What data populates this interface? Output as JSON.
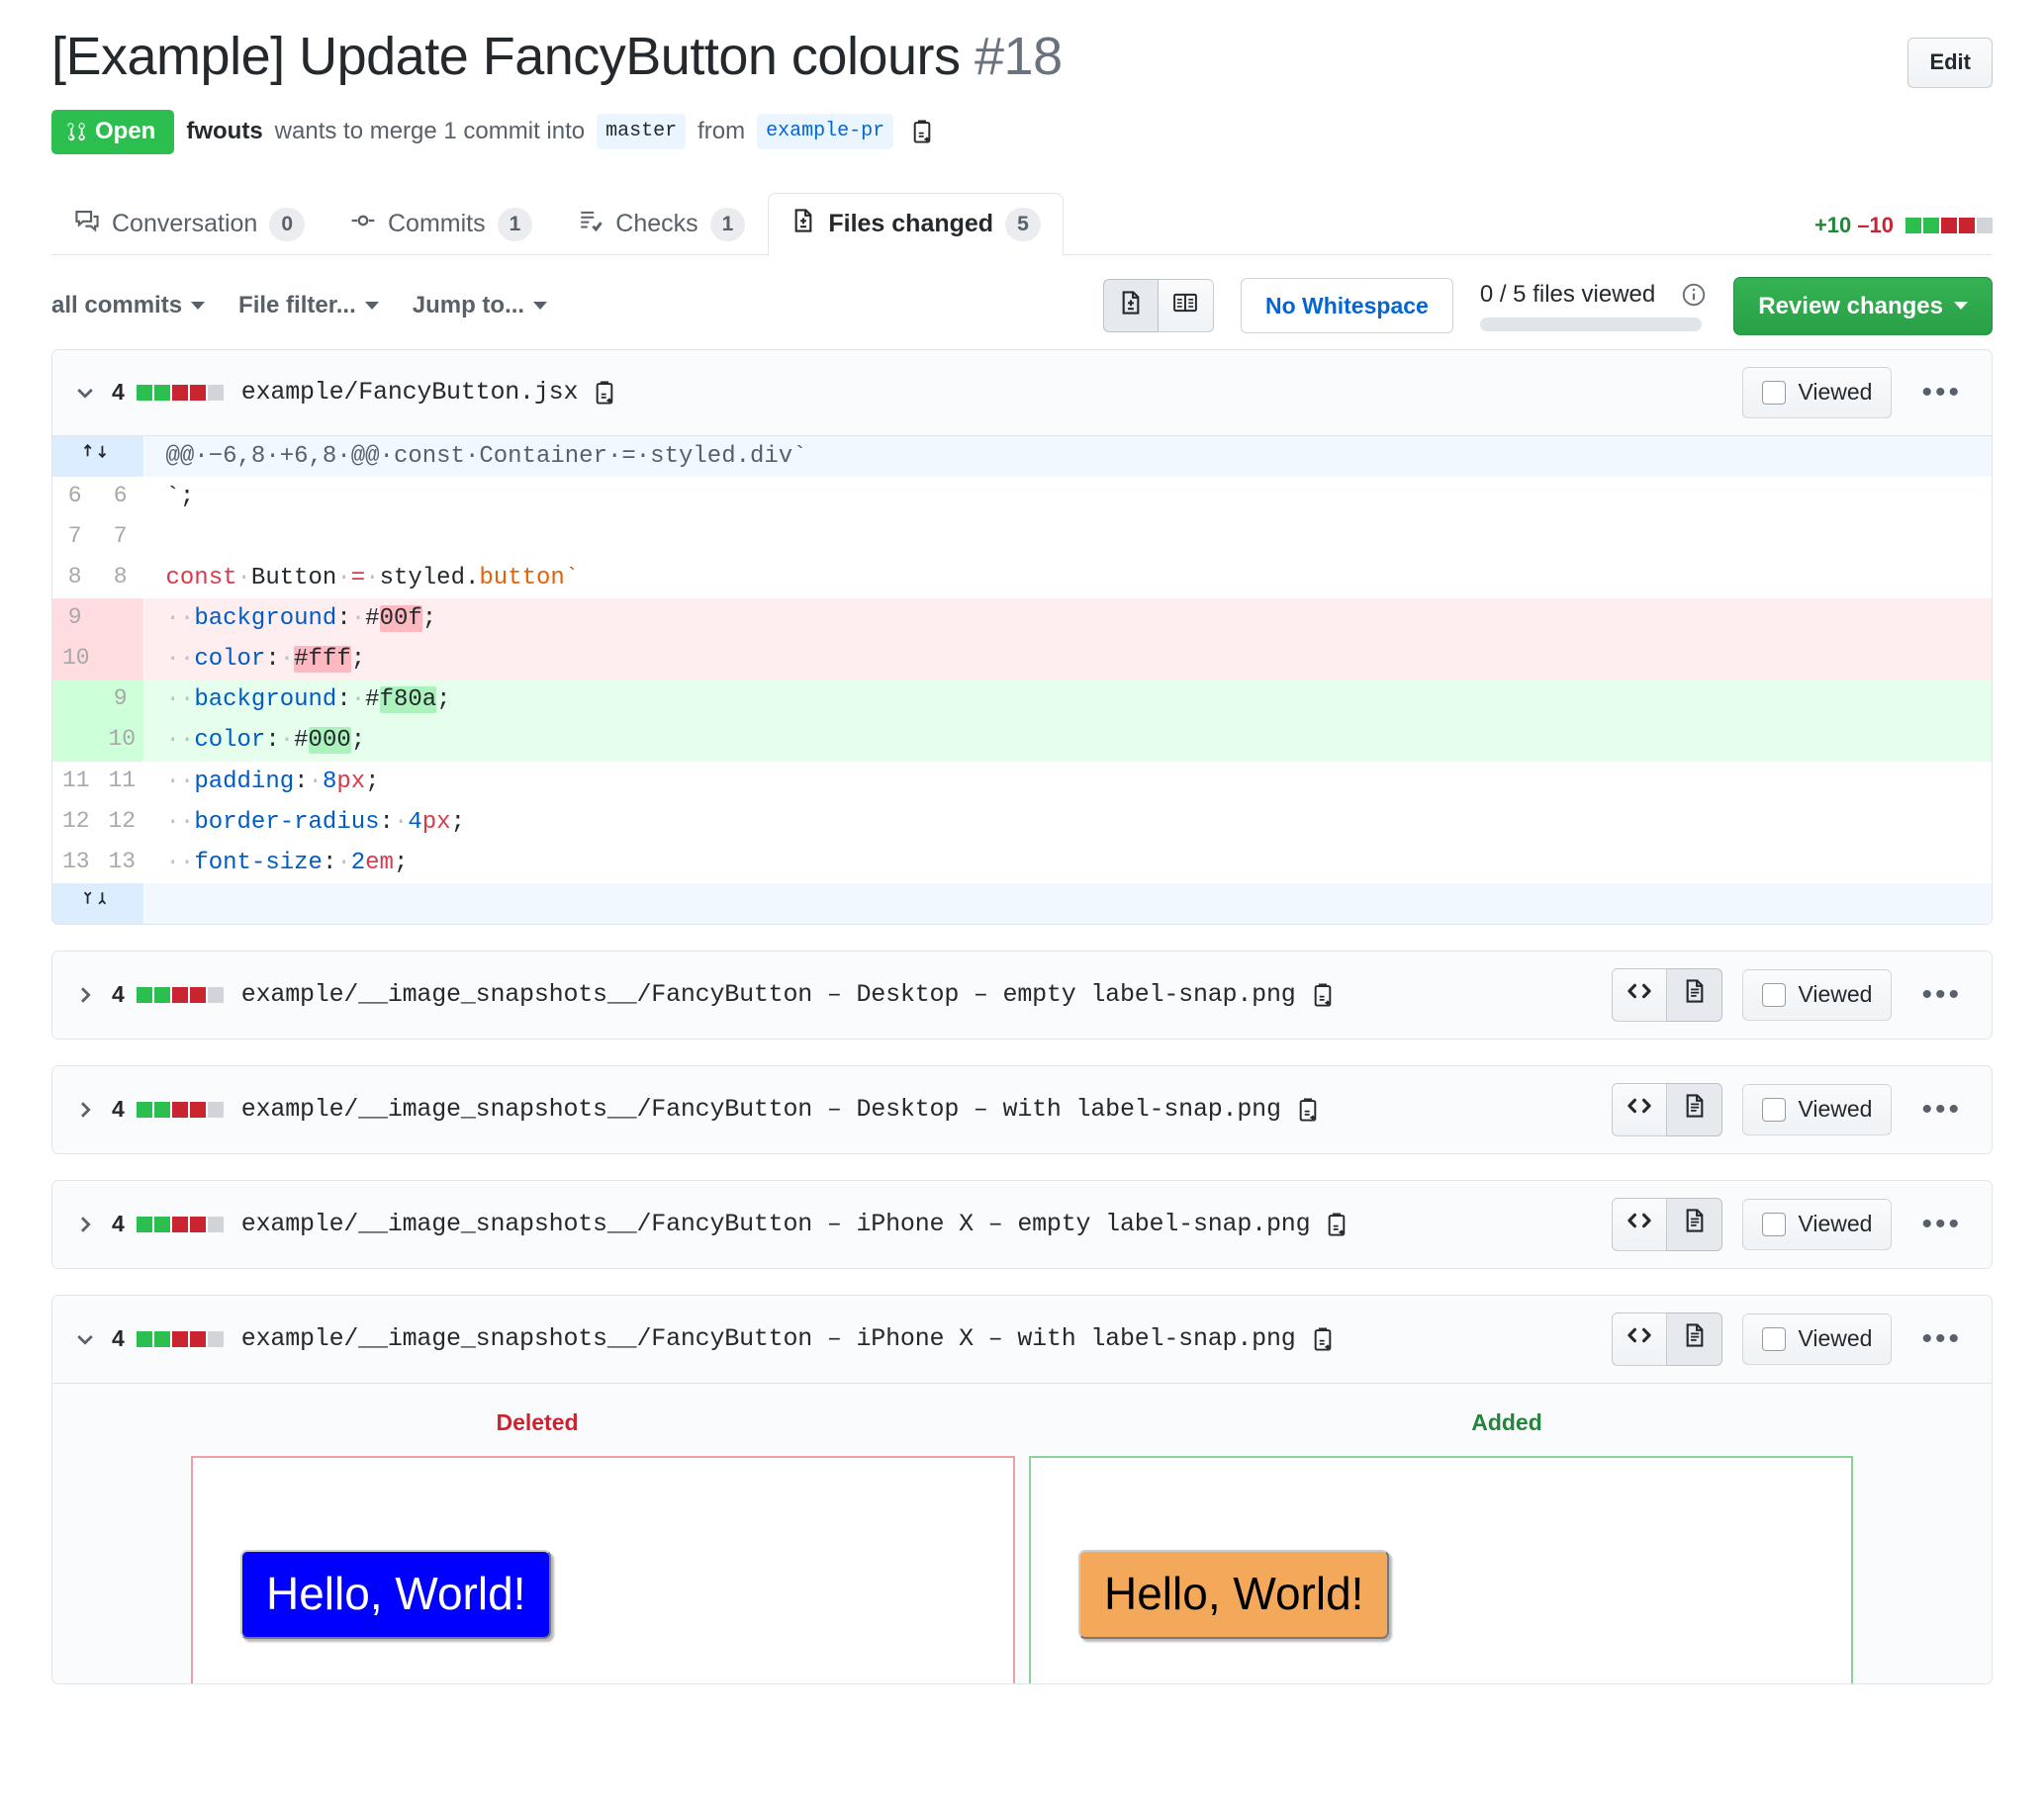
{
  "header": {
    "title": "[Example] Update FancyButton colours",
    "number": "#18",
    "edit_label": "Edit",
    "state": "Open",
    "author": "fwouts",
    "merge_text_1": "wants to merge 1 commit into",
    "base_branch": "master",
    "merge_text_2": "from",
    "head_branch": "example-pr",
    "copy_icon": "copy-to-clipboard-icon"
  },
  "tabs": [
    {
      "label": "Conversation",
      "count": "0",
      "icon": "comment-discussion-icon",
      "selected": false
    },
    {
      "label": "Commits",
      "count": "1",
      "icon": "git-commit-icon",
      "selected": false
    },
    {
      "label": "Checks",
      "count": "1",
      "icon": "checklist-icon",
      "selected": false
    },
    {
      "label": "Files changed",
      "count": "5",
      "icon": "file-diff-icon",
      "selected": true
    }
  ],
  "diffstat": {
    "additions": "+10",
    "deletions": "–10",
    "blocks": [
      "g",
      "g",
      "r",
      "r",
      "n"
    ]
  },
  "toolbar": {
    "commits_filter": "all commits",
    "file_filter": "File filter...",
    "jump_to": "Jump to...",
    "view_unified_icon": "unified-view-icon",
    "view_split_icon": "split-view-icon",
    "whitespace_label": "No Whitespace",
    "files_viewed": "0 / 5 files viewed",
    "info_icon": "info-icon",
    "review_label": "Review changes"
  },
  "colors": {
    "open_green": "#2cbe4e",
    "addition_green": "#22863a",
    "deletion_red": "#cb2431",
    "link_blue": "#0366d6",
    "deleted_button_bg": "#0000ff",
    "deleted_button_fg": "#ffffff",
    "added_button_bg": "#f4a85a",
    "added_button_fg": "#000000"
  },
  "files": [
    {
      "name": "example/FancyButton.jsx",
      "count": "4",
      "blocks": [
        "g",
        "g",
        "r",
        "r",
        "n"
      ],
      "expanded": true,
      "viewed_label": "Viewed",
      "kebab": "•••",
      "chevron": "chevron-down-icon",
      "copy_icon": "copy-path-icon"
    },
    {
      "name": "example/__image_snapshots__/FancyButton – Desktop – empty label-snap.png",
      "count": "4",
      "blocks": [
        "g",
        "g",
        "r",
        "r",
        "n"
      ],
      "expanded": false,
      "viewed_label": "Viewed",
      "kebab": "•••",
      "chevron": "chevron-right-icon",
      "copy_icon": "copy-path-icon"
    },
    {
      "name": "example/__image_snapshots__/FancyButton – Desktop – with label-snap.png",
      "count": "4",
      "blocks": [
        "g",
        "g",
        "r",
        "r",
        "n"
      ],
      "expanded": false,
      "viewed_label": "Viewed",
      "kebab": "•••",
      "chevron": "chevron-right-icon",
      "copy_icon": "copy-path-icon"
    },
    {
      "name": "example/__image_snapshots__/FancyButton – iPhone X – empty label-snap.png",
      "count": "4",
      "blocks": [
        "g",
        "g",
        "r",
        "r",
        "n"
      ],
      "expanded": false,
      "viewed_label": "Viewed",
      "kebab": "•••",
      "chevron": "chevron-right-icon",
      "copy_icon": "copy-path-icon"
    },
    {
      "name": "example/__image_snapshots__/FancyButton – iPhone X – with label-snap.png",
      "count": "4",
      "blocks": [
        "g",
        "g",
        "r",
        "r",
        "n"
      ],
      "expanded": true,
      "viewed_label": "Viewed",
      "kebab": "•••",
      "chevron": "chevron-down-icon",
      "copy_icon": "copy-path-icon"
    }
  ],
  "diff": {
    "hunk_header": "@@·−6,8·+6,8·@@·const·Container·=·styled.div`",
    "lines": [
      {
        "type": "ctx",
        "old": "6",
        "new": "6",
        "text": "`;"
      },
      {
        "type": "ctx",
        "old": "7",
        "new": "7",
        "text": ""
      },
      {
        "type": "ctx",
        "old": "8",
        "new": "8",
        "text": "const Button = styled.button`"
      },
      {
        "type": "del",
        "old": "9",
        "new": "",
        "text": "  background: #00f;"
      },
      {
        "type": "del",
        "old": "10",
        "new": "",
        "text": "  color: #fff;"
      },
      {
        "type": "add",
        "old": "",
        "new": "9",
        "text": "  background: #f80a;"
      },
      {
        "type": "add",
        "old": "",
        "new": "10",
        "text": "  color: #000;"
      },
      {
        "type": "ctx",
        "old": "11",
        "new": "11",
        "text": "  padding: 8px;"
      },
      {
        "type": "ctx",
        "old": "12",
        "new": "12",
        "text": "  border-radius: 4px;"
      },
      {
        "type": "ctx",
        "old": "13",
        "new": "13",
        "text": "  font-size: 2em;"
      }
    ]
  },
  "image_diff": {
    "deleted_label": "Deleted",
    "added_label": "Added",
    "deleted_button_text": "Hello, World!",
    "added_button_text": "Hello, World!"
  }
}
